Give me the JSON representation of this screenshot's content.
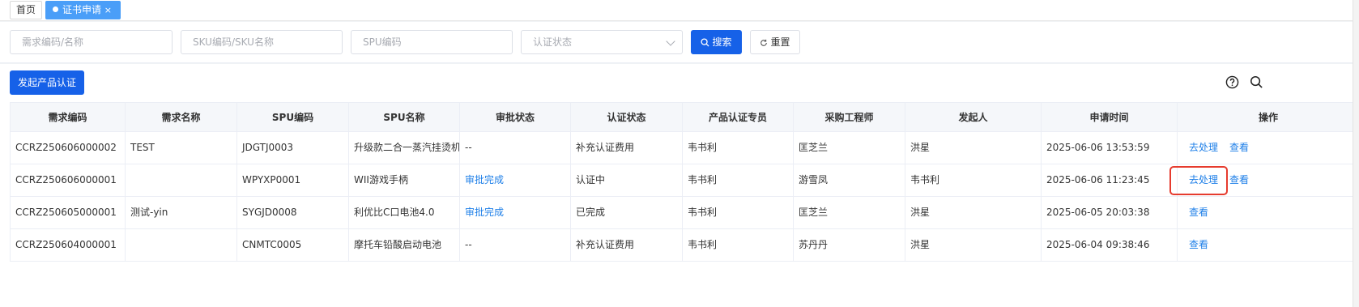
{
  "tabs": {
    "home_label": "首页",
    "active_label": "证书申请",
    "close_glyph": "×"
  },
  "filters": {
    "demand_placeholder": "需求编码/名称",
    "sku_placeholder": "SKU编码/SKU名称",
    "spu_placeholder": "SPU编码",
    "status_placeholder": "认证状态",
    "search_label": "搜索",
    "reset_label": "重置"
  },
  "toolbar": {
    "launch_label": "发起产品认证",
    "help_icon": "question-circle-icon",
    "search_icon": "search-icon"
  },
  "table": {
    "headers": [
      "需求编码",
      "需求名称",
      "SPU编码",
      "SPU名称",
      "审批状态",
      "认证状态",
      "产品认证专员",
      "采购工程师",
      "发起人",
      "申请时间",
      "操作"
    ],
    "rows": [
      {
        "code": "CCRZ250606000002",
        "name": "TEST",
        "spu_code": "JDGTJ0003",
        "spu_name": "升级款二合一蒸汽挂烫机",
        "approval": "--",
        "cert_status": "补充认证费用",
        "specialist": "韦书利",
        "engineer": "匡芝兰",
        "initiator": "洪星",
        "time": "2025-06-06 13:53:59",
        "action1": "去处理",
        "action2": "查看"
      },
      {
        "code": "CCRZ250606000001",
        "name": "",
        "spu_code": "WPYXP0001",
        "spu_name": "WII游戏手柄",
        "approval": "审批完成",
        "cert_status": "认证中",
        "specialist": "韦书利",
        "engineer": "游雪凤",
        "initiator": "韦书利",
        "time": "2025-06-06 11:23:45",
        "action1": "去处理",
        "action2": "查看"
      },
      {
        "code": "CCRZ250605000001",
        "name": "测试-yin",
        "spu_code": "SYGJD0008",
        "spu_name": "利优比C口电池4.0",
        "approval": "审批完成",
        "cert_status": "已完成",
        "specialist": "韦书利",
        "engineer": "匡芝兰",
        "initiator": "洪星",
        "time": "2025-06-05 20:03:38",
        "action1": "查看",
        "action2": ""
      },
      {
        "code": "CCRZ250604000001",
        "name": "",
        "spu_code": "CNMTC0005",
        "spu_name": "摩托车铅酸启动电池",
        "approval": "--",
        "cert_status": "补充认证费用",
        "specialist": "韦书利",
        "engineer": "苏丹丹",
        "initiator": "洪星",
        "time": "2025-06-04 09:38:46",
        "action1": "查看",
        "action2": ""
      }
    ]
  },
  "colors": {
    "primary": "#1661e8",
    "link": "#1e7fe8",
    "highlight": "#e63b2e"
  }
}
